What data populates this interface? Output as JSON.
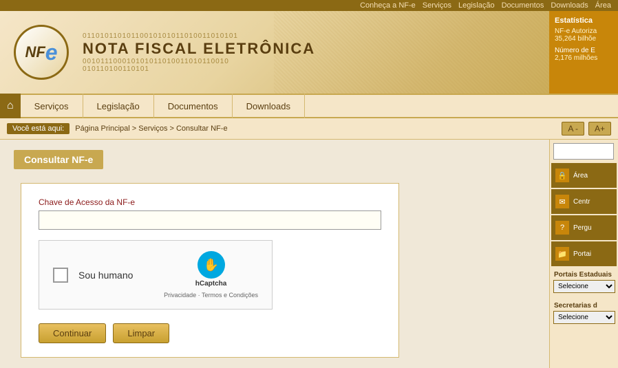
{
  "topnav": {
    "items": [
      "Conheça a NF-e",
      "Serviços",
      "Legislação",
      "Documentos",
      "Downloads",
      "Área"
    ]
  },
  "header": {
    "logo_nf": "NF",
    "logo_e": "e",
    "site_title": "NOTA FISCAL ELETRÔNICA",
    "binary1": "01101011010110010101011010011010101",
    "binary2": "001011100010101011010011010110010",
    "binary3": "010110100110101"
  },
  "stats": {
    "title": "Estatística",
    "nfe_label": "NF-e Autoriza",
    "nfe_value": "35,264 bilhõe",
    "num_label": "Número de E",
    "num_value": "2,176 milhões"
  },
  "mainnav": {
    "home_icon": "⌂",
    "items": [
      {
        "label": "Serviços",
        "active": false
      },
      {
        "label": "Legislação",
        "active": false
      },
      {
        "label": "Documentos",
        "active": false
      },
      {
        "label": "Downloads",
        "active": false
      }
    ]
  },
  "breadcrumb": {
    "you_are_here": "Você está aqui:",
    "path": "Página Principal > Serviços > Consultar NF-e"
  },
  "font_controls": {
    "decrease": "A -",
    "increase": "A+"
  },
  "page": {
    "title": "Consultar NF-e"
  },
  "form": {
    "access_key_label": "Chave de Acesso da NF-e",
    "access_key_placeholder": "",
    "captcha_label": "Sou humano",
    "captcha_brand": "hCaptcha",
    "captcha_links": "Privacidade · Termos e Condições",
    "btn_continue": "Continuar",
    "btn_clear": "Limpar"
  },
  "sidebar": {
    "search_placeholder": "",
    "area_label": "Área",
    "central_label": "Centr",
    "pergu_label": "Pergu",
    "portais_label": "Portai",
    "portais_estaduais_label": "Portais Estaduais",
    "portais_select": "Selecione",
    "secretarias_label": "Secretarias d",
    "secretarias_select": "Selecione"
  }
}
